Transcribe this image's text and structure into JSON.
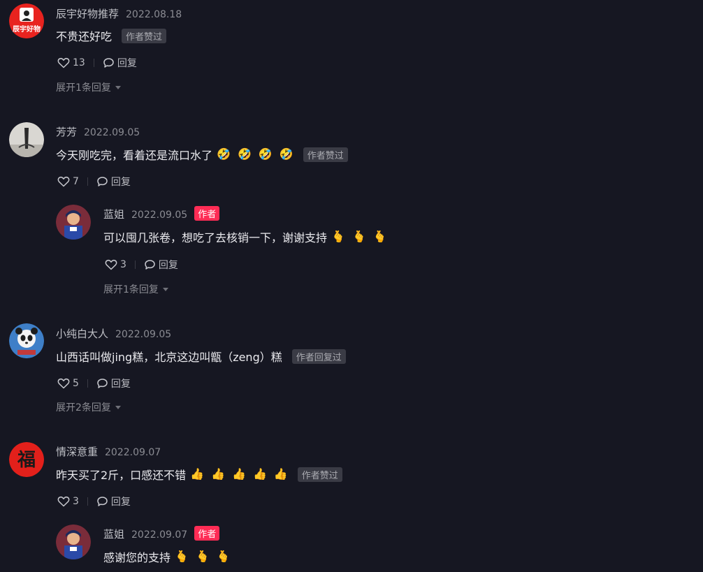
{
  "comments": [
    {
      "user": "辰宇好物推荐",
      "avatar_text": "辰宇好物",
      "date": "2022.08.18",
      "text": "不贵还好吃",
      "emojis": [],
      "tag": "作者赞过",
      "likes": "13",
      "reply_label": "回复",
      "expand": "展开1条回复"
    },
    {
      "user": "芳芳",
      "date": "2022.09.05",
      "text": "今天刚吃完，看着还是流口水了",
      "emojis": [
        "🤣",
        "🤣",
        "🤣",
        "🤣"
      ],
      "tag": "作者赞过",
      "likes": "7",
      "reply_label": "回复",
      "reply": {
        "user": "蓝姐",
        "date": "2022.09.05",
        "badge": "作者",
        "text": "可以囤几张卷，想吃了去核销一下，谢谢支持",
        "emojis": [
          "🫰",
          "🫰",
          "🫰"
        ],
        "likes": "3",
        "reply_label": "回复",
        "expand": "展开1条回复"
      }
    },
    {
      "user": "小纯白大人",
      "date": "2022.09.05",
      "text": "山西话叫做jing糕，北京这边叫甑（zeng）糕",
      "emojis": [],
      "tag": "作者回复过",
      "likes": "5",
      "reply_label": "回复",
      "expand": "展开2条回复"
    },
    {
      "user": "情深意重",
      "avatar_text": "福",
      "date": "2022.09.07",
      "text": "昨天买了2斤，口感还不错",
      "emojis": [
        "👍",
        "👍",
        "👍",
        "👍",
        "👍"
      ],
      "tag": "作者赞过",
      "likes": "3",
      "reply_label": "回复",
      "reply": {
        "user": "蓝姐",
        "date": "2022.09.07",
        "badge": "作者",
        "text": "感谢您的支持",
        "emojis": [
          "🫰",
          "🫰",
          "🫰"
        ]
      }
    }
  ],
  "colors": {
    "background": "#161722",
    "author_badge": "#fe2c55",
    "tag_bg": "#3a3b45"
  }
}
